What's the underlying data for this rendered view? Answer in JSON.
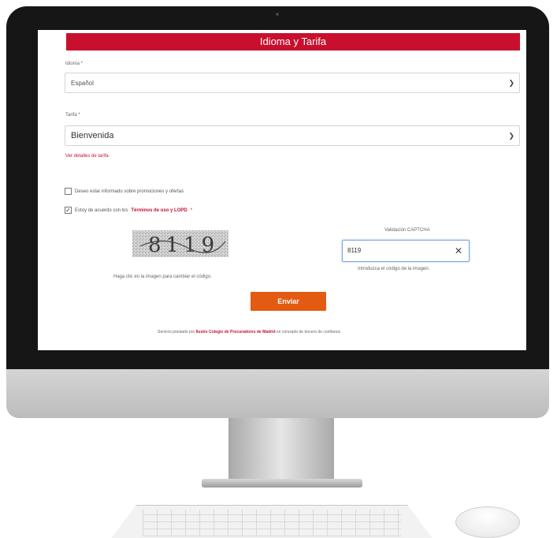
{
  "form": {
    "header": "Idioma y Tarifa",
    "language_label": "Idioma *",
    "language_value": "Español",
    "tariff_label": "Tarifa *",
    "tariff_value": "Bienvenida",
    "tariff_details_link": "Ver detalles de tarifa",
    "promo_checkbox_label": "Deseo estar informado sobre promociones y ofertas",
    "promo_checked": false,
    "terms_prefix": "Estoy de acuerdo con los",
    "terms_link": "Términos de uso y LOPD",
    "terms_suffix": " *",
    "terms_checked": true,
    "captcha_hint": "Haga clic en la imagen para cambiar el código.",
    "captcha_title": "Validación CAPTCHA",
    "captcha_value": "8119",
    "captcha_subtext": "Introduzca el código de la imagen.",
    "submit_label": "Enviar",
    "footer_prefix": "Servicio prestado por ",
    "footer_org": "Ilustre Colegio de Procuradores de Madrid",
    "footer_suffix": " en concepto de tercero de confianza",
    "captcha_image_text": "8119"
  },
  "icons": {
    "chevron": "chevron-down-icon",
    "clear": "close-icon",
    "check": "checkmark-icon"
  },
  "colors": {
    "brand_red": "#c8102e",
    "button_orange": "#e35a12"
  }
}
